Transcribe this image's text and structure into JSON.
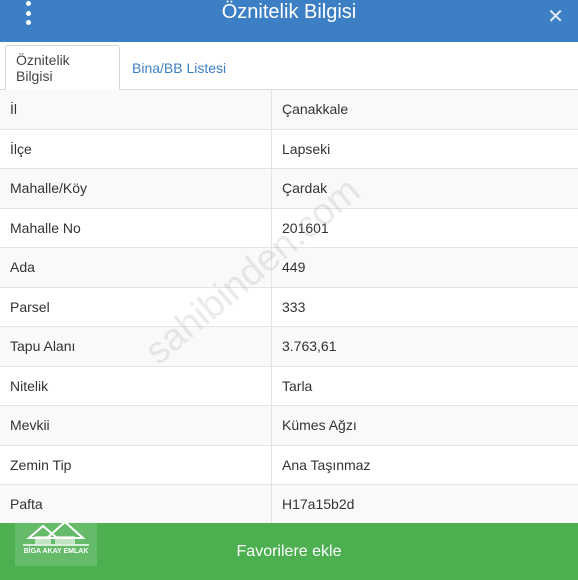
{
  "header": {
    "title": "Öznitelik Bilgisi"
  },
  "tabs": [
    {
      "label": "Öznitelik Bilgisi",
      "active": true
    },
    {
      "label": "Bina/BB Listesi",
      "active": false
    }
  ],
  "rows": [
    {
      "key": "İl",
      "value": "Çanakkale"
    },
    {
      "key": "İlçe",
      "value": "Lapseki"
    },
    {
      "key": "Mahalle/Köy",
      "value": "Çardak"
    },
    {
      "key": "Mahalle No",
      "value": "201601"
    },
    {
      "key": "Ada",
      "value": "449"
    },
    {
      "key": "Parsel",
      "value": "333"
    },
    {
      "key": "Tapu Alanı",
      "value": "3.763,61"
    },
    {
      "key": "Nitelik",
      "value": "Tarla"
    },
    {
      "key": "Mevkii",
      "value": "Kümes Ağzı"
    },
    {
      "key": "Zemin Tip",
      "value": "Ana Taşınmaz"
    },
    {
      "key": "Pafta",
      "value": "H17a15b2d"
    }
  ],
  "watermark": "sahibinden.com",
  "logo": {
    "text": "BİGA AKAY EMLAK"
  },
  "footer": {
    "label": "Favorilere ekle"
  },
  "colors": {
    "header": "#3d7fc4",
    "footer": "#4caf50",
    "tab_active_text": "#444444",
    "tab_link": "#3d7fc4"
  }
}
